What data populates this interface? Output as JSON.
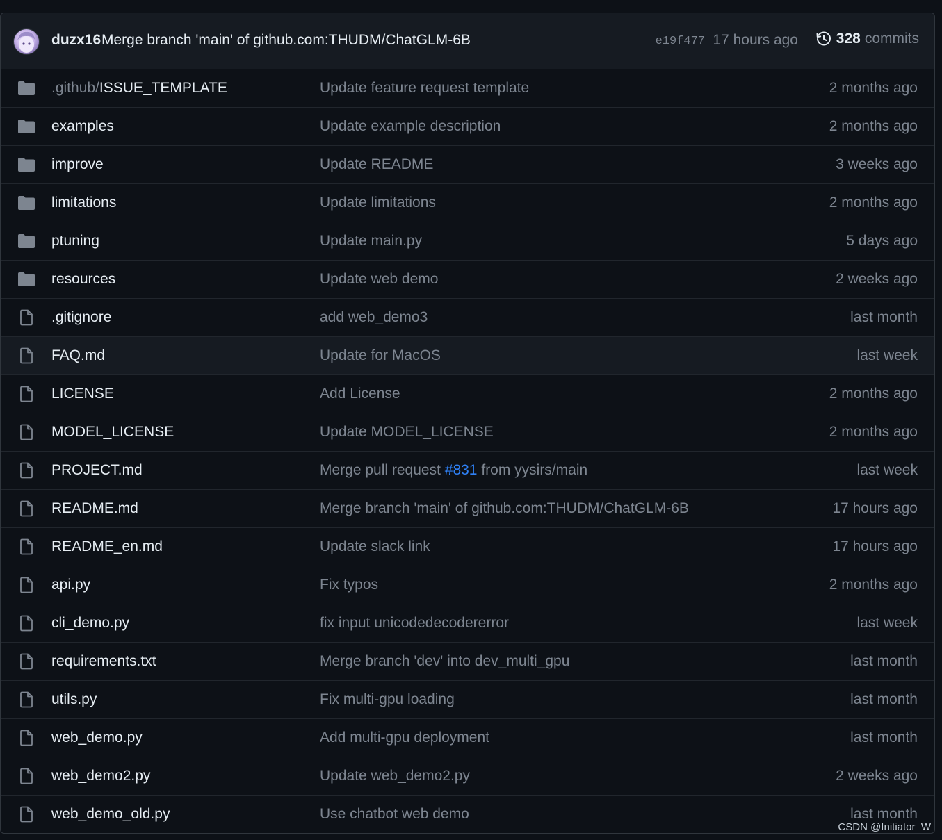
{
  "commit": {
    "author": "duzx16",
    "message": "Merge branch 'main' of github.com:THUDM/ChatGLM-6B",
    "sha": "e19f477",
    "time": "17 hours ago",
    "history_count": "328",
    "history_label": "commits"
  },
  "files": [
    {
      "type": "folder",
      "prefix": ".github/",
      "name": "ISSUE_TEMPLATE",
      "message": "Update feature request template",
      "age": "2 months ago"
    },
    {
      "type": "folder",
      "prefix": "",
      "name": "examples",
      "message": "Update example description",
      "age": "2 months ago"
    },
    {
      "type": "folder",
      "prefix": "",
      "name": "improve",
      "message": "Update README",
      "age": "3 weeks ago"
    },
    {
      "type": "folder",
      "prefix": "",
      "name": "limitations",
      "message": "Update limitations",
      "age": "2 months ago"
    },
    {
      "type": "folder",
      "prefix": "",
      "name": "ptuning",
      "message": "Update main.py",
      "age": "5 days ago"
    },
    {
      "type": "folder",
      "prefix": "",
      "name": "resources",
      "message": "Update web demo",
      "age": "2 weeks ago"
    },
    {
      "type": "file",
      "prefix": "",
      "name": ".gitignore",
      "message": "add web_demo3",
      "age": "last month"
    },
    {
      "type": "file",
      "prefix": "",
      "name": "FAQ.md",
      "message": "Update for MacOS",
      "age": "last week",
      "highlight": true
    },
    {
      "type": "file",
      "prefix": "",
      "name": "LICENSE",
      "message": "Add License",
      "age": "2 months ago"
    },
    {
      "type": "file",
      "prefix": "",
      "name": "MODEL_LICENSE",
      "message": "Update MODEL_LICENSE",
      "age": "2 months ago"
    },
    {
      "type": "file",
      "prefix": "",
      "name": "PROJECT.md",
      "message": "Merge pull request ",
      "link": "#831",
      "message_tail": " from yysirs/main",
      "age": "last week"
    },
    {
      "type": "file",
      "prefix": "",
      "name": "README.md",
      "message": "Merge branch 'main' of github.com:THUDM/ChatGLM-6B",
      "age": "17 hours ago"
    },
    {
      "type": "file",
      "prefix": "",
      "name": "README_en.md",
      "message": "Update slack link",
      "age": "17 hours ago"
    },
    {
      "type": "file",
      "prefix": "",
      "name": "api.py",
      "message": "Fix typos",
      "age": "2 months ago"
    },
    {
      "type": "file",
      "prefix": "",
      "name": "cli_demo.py",
      "message": "fix input unicodedecodererror",
      "age": "last week"
    },
    {
      "type": "file",
      "prefix": "",
      "name": "requirements.txt",
      "message": "Merge branch 'dev' into dev_multi_gpu",
      "age": "last month"
    },
    {
      "type": "file",
      "prefix": "",
      "name": "utils.py",
      "message": "Fix multi-gpu loading",
      "age": "last month"
    },
    {
      "type": "file",
      "prefix": "",
      "name": "web_demo.py",
      "message": "Add multi-gpu deployment",
      "age": "last month"
    },
    {
      "type": "file",
      "prefix": "",
      "name": "web_demo2.py",
      "message": "Update web_demo2.py",
      "age": "2 weeks ago"
    },
    {
      "type": "file",
      "prefix": "",
      "name": "web_demo_old.py",
      "message": "Use chatbot web demo",
      "age": "last month"
    }
  ],
  "watermark": "CSDN @Initiator_W"
}
